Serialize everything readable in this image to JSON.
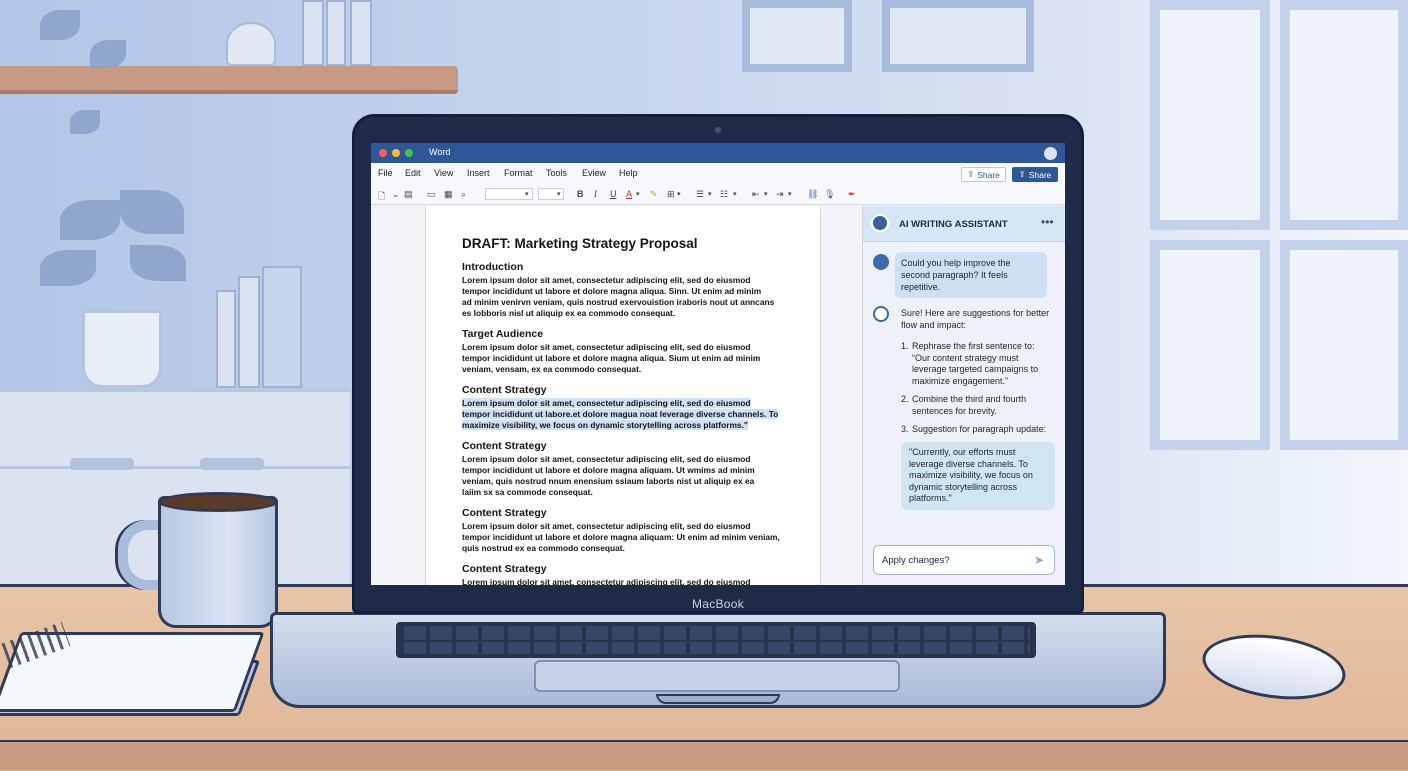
{
  "app": {
    "title": "Word",
    "device_label": "MacBook"
  },
  "menu": [
    "File",
    "Edit",
    "View",
    "Insert",
    "Format",
    "Tools",
    "Eview",
    "Help"
  ],
  "share_buttons": [
    "Share",
    "Share"
  ],
  "toolbar": {
    "bold": "B",
    "italic": "I",
    "underline": "U",
    "font_color": "A"
  },
  "document": {
    "title": "DRAFT: Marketing Strategy Proposal",
    "sections": [
      {
        "heading": "Introduction",
        "lines": [
          "Lorem ipsum dolor sit amet, consectetur adipiscing elit, sed do eiusmod",
          "tempor incididunt ut labore et dolore magna aliqua. Sinn. Ut enim ad minim",
          "ad minim venirvn veniam, quis nostrud exervouistion iraboris nout ut anncans",
          "es lobboris nisl ut aliquip ex ea commodo consequat."
        ]
      },
      {
        "heading": "Target Audience",
        "lines": [
          "Lorem ipsum dolor sit amet, consectetur adipiscing elit, sed do eiusmod",
          "tempor incididunt ut labore et dolore magna aliqua. Sium ut enim ad minim",
          "veniam, vensam, ex ea commodo consequat."
        ]
      },
      {
        "heading": "Content Strategy",
        "lines": [
          "Lorem ipsum dolor sit amet, consectetur adipiscing elit, sed do eiusmod",
          "tempor incididunt ut labore.et dolore magua noat leverage diverse channels. To",
          "maximize visibility, we focus on dynamic storytelling across platforms.\""
        ]
      },
      {
        "heading": "Content Strategy",
        "lines": [
          "Lorem ipsum dolor sit amet, consectetur adipiscing elit, sed do eiusmod",
          "tempor incididunt ut labore et dolore magna aliquam. Ut wmims ad minim",
          "veniam, quis nostrud nnum enensium ssiaum laborts nist ut aliquip ex ea",
          "laiim sx sa commode consequat."
        ]
      },
      {
        "heading": "Content Strategy",
        "lines": [
          "Lorem ipsum dolor sit amet, consectetur adipiscing elit, sed do eiusmod",
          "tempor incididunt ut labore et dolore magna aliquam: Ut enim ad minim veniam,",
          "quis nostrud ex ea commodo consequat."
        ]
      },
      {
        "heading": "Content Strategy",
        "lines": [
          "Lorem ipsum dolor sit amet, consectetur adipiscing elit, sed do eiusmod"
        ]
      }
    ]
  },
  "assistant": {
    "title": "AI WRITING ASSISTANT",
    "more": "•••",
    "user_message": "Could you help improve the second paragraph? It feels repetitive.",
    "ai_intro": "Sure! Here are suggestions for better flow and impact:",
    "suggestions": [
      {
        "num": "1.",
        "text": "Rephrase the first sentence to: “Our content strategy must leverage targeted campaigns to maximize engagement.”"
      },
      {
        "num": "2.",
        "text": "Combine the third and fourth sentences for brevity."
      },
      {
        "num": "3.",
        "text": "Suggestion for paragraph update:"
      }
    ],
    "quote": "\"Currently, our efforts must leverage diverse channels. To maximize visibility, we focus on dynamic storytelling across platforms.\"",
    "input_value": "Apply changes?"
  },
  "colors": {
    "titlebar": "#2f5697",
    "highlight": "#cfe0f7",
    "panel_header": "#d7e6f6"
  }
}
